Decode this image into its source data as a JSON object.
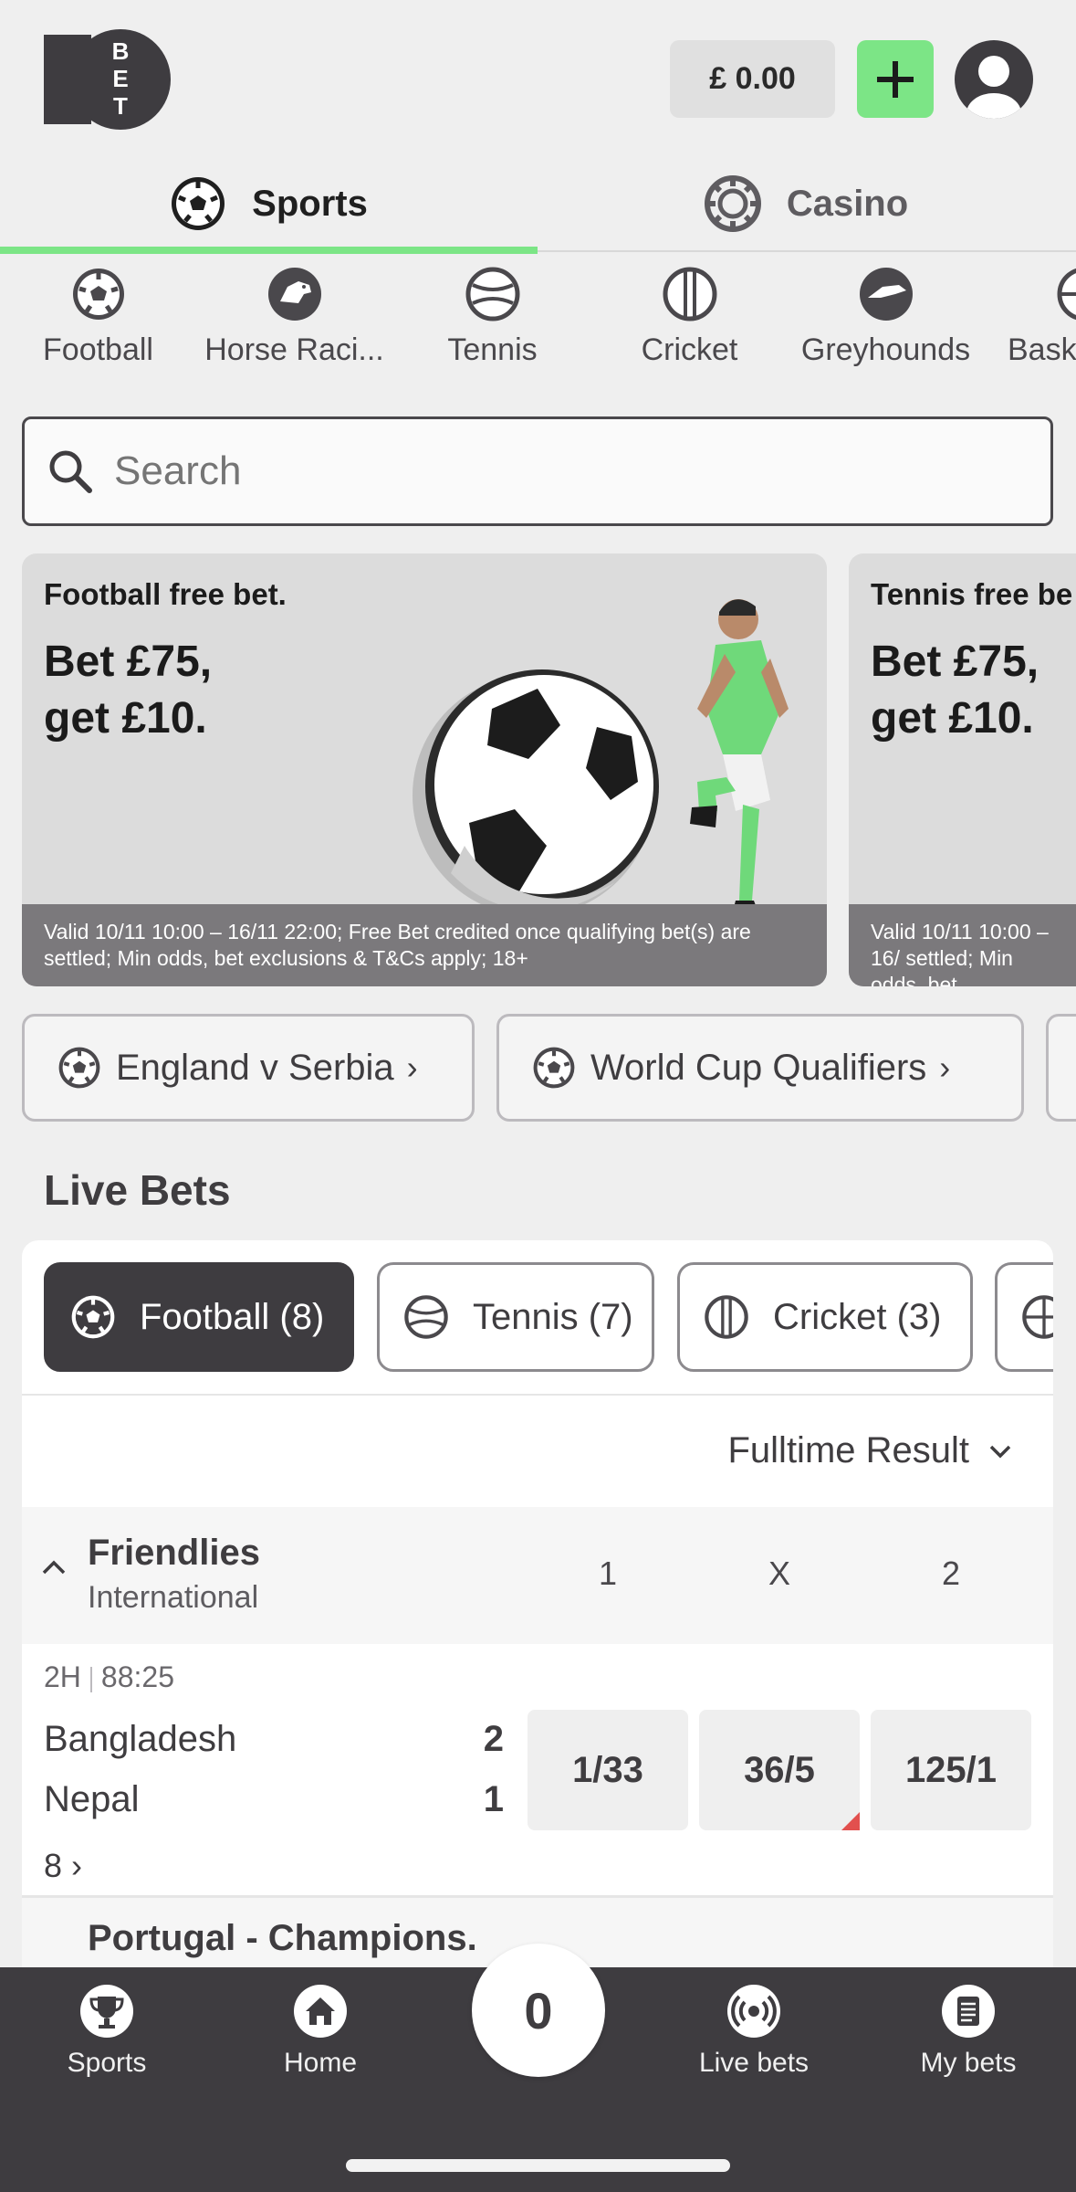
{
  "header": {
    "balance": "£ 0.00",
    "logo_text": "10BET"
  },
  "top_tabs": [
    {
      "label": "Sports",
      "active": true
    },
    {
      "label": "Casino",
      "active": false
    }
  ],
  "sports": [
    {
      "label": "Football",
      "icon": "football-icon"
    },
    {
      "label": "Horse Raci...",
      "icon": "horse-icon"
    },
    {
      "label": "Tennis",
      "icon": "tennis-icon"
    },
    {
      "label": "Cricket",
      "icon": "cricket-icon"
    },
    {
      "label": "Greyhounds",
      "icon": "greyhound-icon"
    },
    {
      "label": "Bask",
      "icon": "basketball-icon"
    }
  ],
  "search": {
    "placeholder": "Search"
  },
  "promos": [
    {
      "small": "Football free bet.",
      "line1": "Bet £75,",
      "line2": "get £10.",
      "terms": "Valid 10/11 10:00 – 16/11 22:00; Free Bet credited once qualifying bet(s) are settled; Min odds, bet exclusions & T&Cs apply; 18+"
    },
    {
      "small": "Tennis free be",
      "line1": "Bet £75,",
      "line2": "get £10.",
      "terms": "Valid 10/11 10:00 – 16/ settled; Min odds, bet"
    }
  ],
  "quick_links": [
    {
      "label": "England v Serbia"
    },
    {
      "label": "World Cup Qualifiers"
    }
  ],
  "live_bets": {
    "title": "Live Bets",
    "pills": [
      {
        "label": "Football (8)",
        "active": true
      },
      {
        "label": "Tennis (7)",
        "active": false
      },
      {
        "label": "Cricket (3)",
        "active": false
      }
    ],
    "market": "Fulltime Result",
    "columns": [
      "1",
      "X",
      "2"
    ],
    "league": {
      "name": "Friendlies",
      "sub": "International"
    },
    "event": {
      "period": "2H",
      "clock": "88:25",
      "home": "Bangladesh",
      "away": "Nepal",
      "home_score": "2",
      "away_score": "1",
      "odds": [
        "1/33",
        "36/5",
        "125/1"
      ],
      "more_markets": "8"
    },
    "league2": {
      "name": "Portugal - Champions."
    }
  },
  "bottom_nav": {
    "items": [
      {
        "label": "Sports"
      },
      {
        "label": "Home"
      },
      {
        "label": "Live bets"
      },
      {
        "label": "My bets"
      }
    ],
    "betslip_count": "0"
  },
  "colors": {
    "accent": "#7ce586",
    "dark": "#3e3c40",
    "odds_drift": "#e2504e"
  }
}
